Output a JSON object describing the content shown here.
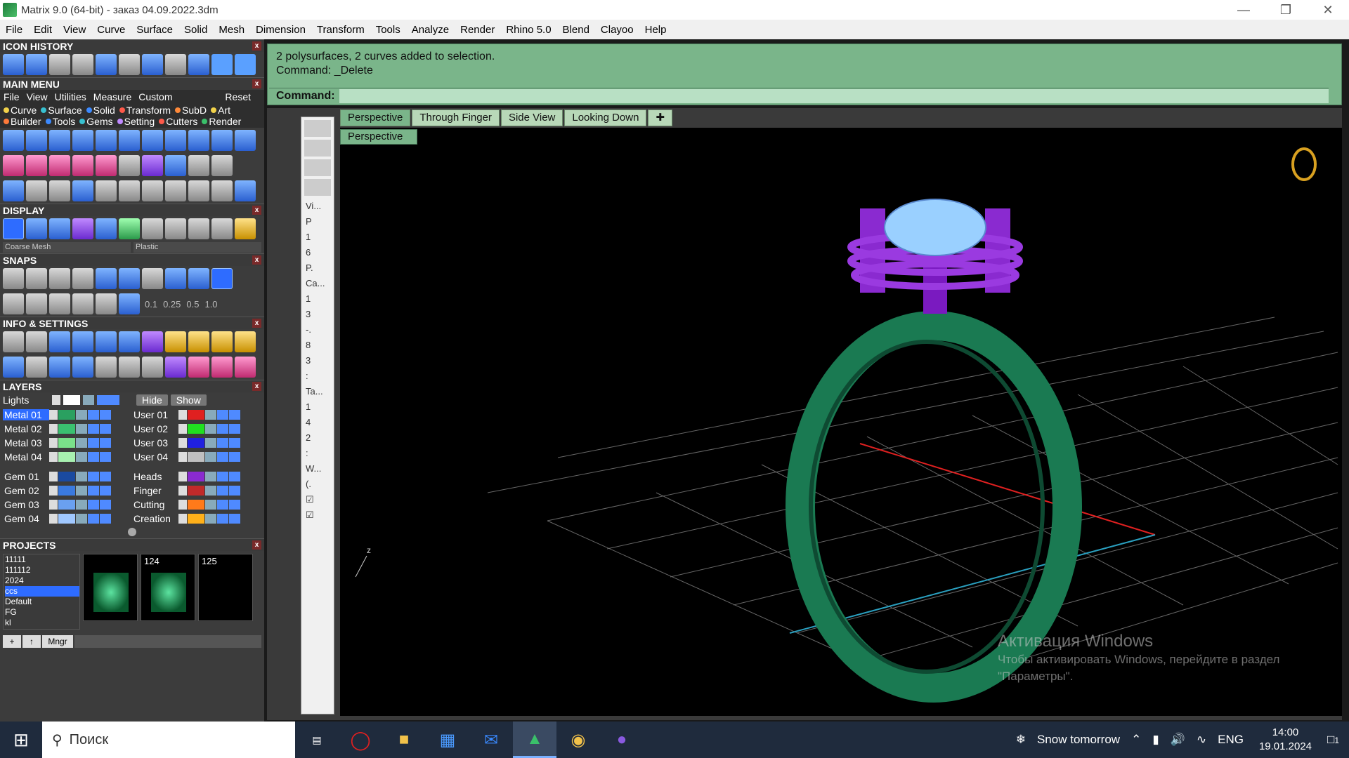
{
  "window": {
    "title": "Matrix 9.0 (64-bit) - заказ 04.09.2022.3dm"
  },
  "menu": [
    "File",
    "Edit",
    "View",
    "Curve",
    "Surface",
    "Solid",
    "Mesh",
    "Dimension",
    "Transform",
    "Tools",
    "Analyze",
    "Render",
    "Rhino 5.0",
    "Blend",
    "Clayoo",
    "Help"
  ],
  "panels": {
    "icon_history": "ICON HISTORY",
    "main_menu": "MAIN MENU",
    "display": "DISPLAY",
    "snaps": "SNAPS",
    "info_settings": "INFO & SETTINGS",
    "layers": "LAYERS",
    "projects": "PROJECTS"
  },
  "main_menu_bar": [
    "File",
    "View",
    "Utilities",
    "Measure",
    "Custom",
    "Reset"
  ],
  "main_menu_tabs": [
    {
      "label": "Curve",
      "color": "#f2d24a"
    },
    {
      "label": "Surface",
      "color": "#38c0d0"
    },
    {
      "label": "Solid",
      "color": "#3c8aff"
    },
    {
      "label": "Transform",
      "color": "#ff5a4a"
    },
    {
      "label": "SubD",
      "color": "#ff8a3a"
    },
    {
      "label": "Art",
      "color": "#f2d24a"
    },
    {
      "label": "Builder",
      "color": "#ff7a3a"
    },
    {
      "label": "Tools",
      "color": "#3c8aff"
    },
    {
      "label": "Gems",
      "color": "#38c0d0"
    },
    {
      "label": "Setting",
      "color": "#c08aff"
    },
    {
      "label": "Cutters",
      "color": "#ff5a4a"
    },
    {
      "label": "Render",
      "color": "#3ac06a"
    }
  ],
  "display": {
    "mesh_select": "Coarse Mesh",
    "material_select": "Plastic"
  },
  "snaps": {
    "values": [
      "0.1",
      "0.25",
      "0.5",
      "1.0"
    ]
  },
  "layers": {
    "lights_label": "Lights",
    "hide_label": "Hide",
    "show_label": "Show",
    "left": [
      {
        "name": "Metal 01",
        "color": "#2aa060",
        "selected": true
      },
      {
        "name": "Metal 02",
        "color": "#3ac070"
      },
      {
        "name": "Metal 03",
        "color": "#7ae08a"
      },
      {
        "name": "Metal 04",
        "color": "#a8f0b0"
      },
      {
        "name": "Gem 01",
        "color": "#1a4aa0"
      },
      {
        "name": "Gem 02",
        "color": "#3a7ae0"
      },
      {
        "name": "Gem 03",
        "color": "#6aa0f0"
      },
      {
        "name": "Gem 04",
        "color": "#a0c8ff"
      }
    ],
    "right": [
      {
        "name": "User 01",
        "color": "#e02020"
      },
      {
        "name": "User 02",
        "color": "#20e020"
      },
      {
        "name": "User 03",
        "color": "#2020e0"
      },
      {
        "name": "User 04",
        "color": "#c0c0c0"
      },
      {
        "name": "Heads",
        "color": "#8a2ad0"
      },
      {
        "name": "Finger",
        "color": "#c02a2a"
      },
      {
        "name": "Cutting",
        "color": "#ff7a1a"
      },
      {
        "name": "Creation",
        "color": "#ffb01a"
      }
    ]
  },
  "projects": {
    "list": [
      "11111",
      "111112",
      "2024",
      "ccs",
      "Default",
      "FG",
      "kl"
    ],
    "selected": "ccs",
    "thumbs": [
      "",
      "124",
      "125"
    ],
    "mngr": "Mngr"
  },
  "command": {
    "history_1": "2 polysurfaces, 2 curves added to selection.",
    "history_2": "Command: _Delete",
    "prompt": "Command:"
  },
  "side_items": [
    "Vi...",
    "P",
    "1",
    "6",
    "P.",
    "Ca...",
    "1",
    "3",
    "-.",
    "8",
    "3",
    ":",
    "Ta...",
    "1",
    "4",
    "2",
    ":",
    "W...",
    "(.",
    "☑",
    "☑"
  ],
  "viewport_tabs": [
    "Perspective",
    "Through Finger",
    "Side View",
    "Looking Down"
  ],
  "viewport_name": "Perspective",
  "watermark": {
    "title": "Активация Windows",
    "line1": "Чтобы активировать Windows, перейдите в раздел",
    "line2": "\"Параметры\"."
  },
  "taskbar": {
    "search": "Поиск",
    "weather": "Snow tomorrow",
    "lang": "ENG",
    "time": "14:00",
    "date": "19.01.2024",
    "notif": "1"
  },
  "colors": {
    "ring": "#1a7a52",
    "heads": "#8a2ad0",
    "gem": "#9ad0ff",
    "cmd_bg": "#7ab58a"
  }
}
